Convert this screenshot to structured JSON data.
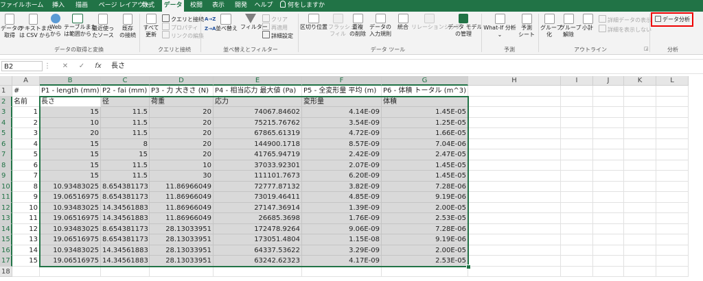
{
  "tabs": [
    {
      "label": "ファイル",
      "active": false
    },
    {
      "label": "ホーム",
      "active": false
    },
    {
      "label": "挿入",
      "active": false
    },
    {
      "label": "描画",
      "active": false
    },
    {
      "label": "ページ レイアウト",
      "active": false
    },
    {
      "label": "数式",
      "active": false
    },
    {
      "label": "データ",
      "active": true
    },
    {
      "label": "校閲",
      "active": false
    },
    {
      "label": "表示",
      "active": false
    },
    {
      "label": "開発",
      "active": false
    },
    {
      "label": "ヘルプ",
      "active": false
    },
    {
      "label": "何をしますか",
      "active": false
    }
  ],
  "ribbon": {
    "get_data": {
      "l1": "データの",
      "l2": "取得"
    },
    "text_csv": {
      "l1": "テキストまた",
      "l2": "は CSV から"
    },
    "web": {
      "l1": "Web",
      "l2": "から"
    },
    "from_table": {
      "l1": "テーブルまた",
      "l2": "は範囲から"
    },
    "recent_sources": {
      "l1": "最近使っ",
      "l2": "たソース"
    },
    "existing_conn": {
      "l1": "既存",
      "l2": "の接続"
    },
    "group_get_transform": "データの取得と変換",
    "refresh_all": {
      "l1": "すべて",
      "l2": "更新"
    },
    "queries_connections": "クエリと接続",
    "properties": "プロパティ",
    "edit_links": "リンクの編集",
    "group_queries": "クエリと接続",
    "sort_asc": "A→Z",
    "sort_desc": "Z→A",
    "sort": "並べ替え",
    "filter": "フィルター",
    "clear": "クリア",
    "reapply": "再適用",
    "advanced": "詳細設定",
    "group_sort_filter": "並べ替えとフィルター",
    "text_to_columns": "区切り位置",
    "flash_fill": {
      "l1": "フラッシュ",
      "l2": "フィル"
    },
    "remove_duplicates": {
      "l1": "重複",
      "l2": "の削除"
    },
    "data_validation": {
      "l1": "データの",
      "l2": "入力規則"
    },
    "consolidate": "統合",
    "relationships": "リレーションシップ",
    "data_model": {
      "l1": "データ モデル",
      "l2": "の管理"
    },
    "group_data_tools": "データ ツール",
    "whatif": {
      "l1": "What-If 分析",
      "l2": ""
    },
    "forecast": {
      "l1": "予測",
      "l2": "シート"
    },
    "group_forecast": "予測",
    "group_btn": {
      "l1": "グループ",
      "l2": "化"
    },
    "ungroup_btn": {
      "l1": "グループ",
      "l2": "解除"
    },
    "subtotal": {
      "l1": "小計",
      "l2": ""
    },
    "show_detail": "詳細データの表示",
    "hide_detail": "詳細を表示しない",
    "group_outline": "アウトライン",
    "data_analysis": "データ分析",
    "group_analysis": "分析",
    "colors": {
      "accent": "#217346",
      "highlight": "#e00000",
      "selection": "#d9d9d9"
    }
  },
  "formula_bar": {
    "name_box": "B2",
    "cancel_icon": "✕",
    "enter_icon": "✓",
    "fx_label": "fx",
    "value": "長さ"
  },
  "sheet": {
    "columns": [
      "A",
      "B",
      "C",
      "D",
      "E",
      "F",
      "G",
      "H",
      "I",
      "J",
      "K",
      "L"
    ],
    "row_numbers": [
      "1",
      "2",
      "3",
      "4",
      "5",
      "6",
      "7",
      "8",
      "9",
      "10",
      "11",
      "12",
      "13",
      "14",
      "15",
      "16",
      "17",
      "18"
    ],
    "rows": [
      [
        "#",
        "P1 - length (mm)",
        "P2 - fai (mm)",
        "P3 - 力 大きさ (N)",
        "P4 - 相当応力 最大値 (Pa)",
        "P5 - 全変形量 平均 (m)",
        "P6 - 体積 トータル (m^3)"
      ],
      [
        "名前",
        "長さ",
        "径",
        "荷重",
        "応力",
        "変形量",
        "体積"
      ],
      [
        "1",
        "15",
        "11.5",
        "20",
        "74067.84602",
        "4.14E-09",
        "1.45E-05"
      ],
      [
        "2",
        "10",
        "11.5",
        "20",
        "75215.76762",
        "3.54E-09",
        "1.25E-05"
      ],
      [
        "3",
        "20",
        "11.5",
        "20",
        "67865.61319",
        "4.72E-09",
        "1.66E-05"
      ],
      [
        "4",
        "15",
        "8",
        "20",
        "144900.1718",
        "8.57E-09",
        "7.04E-06"
      ],
      [
        "5",
        "15",
        "15",
        "20",
        "41765.94719",
        "2.42E-09",
        "2.47E-05"
      ],
      [
        "6",
        "15",
        "11.5",
        "10",
        "37033.92301",
        "2.07E-09",
        "1.45E-05"
      ],
      [
        "7",
        "15",
        "11.5",
        "30",
        "111101.7673",
        "6.20E-09",
        "1.45E-05"
      ],
      [
        "8",
        "10.93483025",
        "8.654381173",
        "11.86966049",
        "72777.87132",
        "3.82E-09",
        "7.28E-06"
      ],
      [
        "9",
        "19.06516975",
        "8.654381173",
        "11.86966049",
        "73019.46411",
        "4.85E-09",
        "9.19E-06"
      ],
      [
        "10",
        "10.93483025",
        "14.34561883",
        "11.86966049",
        "27147.36914",
        "1.39E-09",
        "2.00E-05"
      ],
      [
        "11",
        "19.06516975",
        "14.34561883",
        "11.86966049",
        "26685.3698",
        "1.76E-09",
        "2.53E-05"
      ],
      [
        "12",
        "10.93483025",
        "8.654381173",
        "28.13033951",
        "172478.9264",
        "9.06E-09",
        "7.28E-06"
      ],
      [
        "13",
        "19.06516975",
        "8.654381173",
        "28.13033951",
        "173051.4804",
        "1.15E-08",
        "9.19E-06"
      ],
      [
        "14",
        "10.93483025",
        "14.34561883",
        "28.13033951",
        "64337.53622",
        "3.29E-09",
        "2.00E-05"
      ],
      [
        "15",
        "19.06516975",
        "14.34561883",
        "28.13033951",
        "63242.62323",
        "4.17E-09",
        "2.53E-05"
      ],
      [
        "",
        "",
        "",
        "",
        "",
        "",
        ""
      ]
    ]
  }
}
